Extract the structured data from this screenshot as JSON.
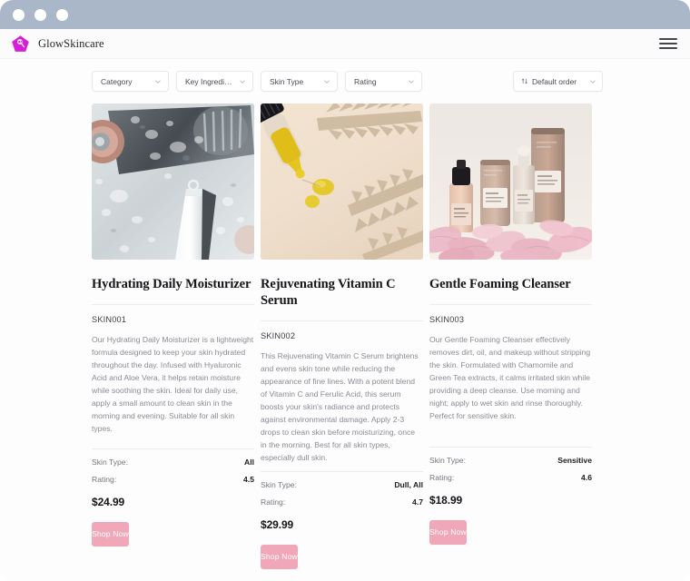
{
  "window": {
    "titlebar_dots": 3
  },
  "header": {
    "brand_name": "GlowSkincare",
    "logo_icon": "pentagon-droplet-logo",
    "menu_icon": "hamburger-menu-icon",
    "brand_color": "#d61fd6"
  },
  "filters": {
    "items": [
      {
        "label": "Category",
        "icon": "chevron-down-icon"
      },
      {
        "label": "Key Ingredien...",
        "icon": "chevron-down-icon"
      },
      {
        "label": "Skin Type",
        "icon": "chevron-down-icon"
      },
      {
        "label": "Rating",
        "icon": "chevron-down-icon"
      }
    ],
    "sort": {
      "label": "Default order",
      "icon": "sort-arrows-icon",
      "chevron": "chevron-down-icon"
    }
  },
  "products": [
    {
      "title": "Hydrating Daily Moisturizer",
      "sku": "SKIN001",
      "description": "Our Hydrating Daily Moisturizer is a lightweight formula designed to keep your skin hydrated throughout the day. Infused with Hyaluronic Acid and Aloe Vera, it helps retain moisture while soothing the skin. Ideal for daily use, apply a small amount to clean skin in the morning and evening. Suitable for all skin types.",
      "specs": [
        {
          "label": "Skin Type:",
          "value": "All"
        },
        {
          "label": "Rating:",
          "value": "4.5"
        }
      ],
      "price": "$24.99",
      "cta": "Shop Now",
      "image_alt": "white-cosmetic-tube-on-wet-grey-surface"
    },
    {
      "title": "Rejuvenating Vitamin C Serum",
      "sku": "SKIN002",
      "description": "This Rejuvenating Vitamin C Serum brightens and evens skin tone while reducing the appearance of fine lines. With a potent blend of Vitamin C and Ferulic Acid, this serum boosts your skin's radiance and protects against environmental damage. Apply 2-3 drops to clean skin before moisturizing, once in the morning. Best for all skin types, especially dull skin.",
      "specs": [
        {
          "label": "Skin Type:",
          "value": "Dull, All"
        },
        {
          "label": "Rating:",
          "value": "4.7"
        }
      ],
      "price": "$29.99",
      "cta": "Shop Now",
      "image_alt": "serum-dropper-with-yellow-oil-and-leaf-shadow"
    },
    {
      "title": "Gentle Foaming Cleanser",
      "sku": "SKIN003",
      "description": "Our Gentle Foaming Cleanser effectively removes dirt, oil, and makeup without stripping the skin. Formulated with Chamomile and Green Tea extracts, it calms irritated skin while providing a deep cleanse. Use morning and night; apply to wet skin and rinse thoroughly. Perfect for sensitive skin.",
      "specs": [
        {
          "label": "Skin Type:",
          "value": "Sensitive"
        },
        {
          "label": "Rating:",
          "value": "4.6"
        }
      ],
      "price": "$18.99",
      "cta": "Shop Now",
      "image_alt": "skincare-bottles-on-pink-petals"
    }
  ],
  "colors": {
    "titlebar": "#aab7c8",
    "button": "#f0a8b9",
    "logo": "#d61fd6",
    "text_primary": "#16161a",
    "text_muted": "#8b8b95"
  }
}
